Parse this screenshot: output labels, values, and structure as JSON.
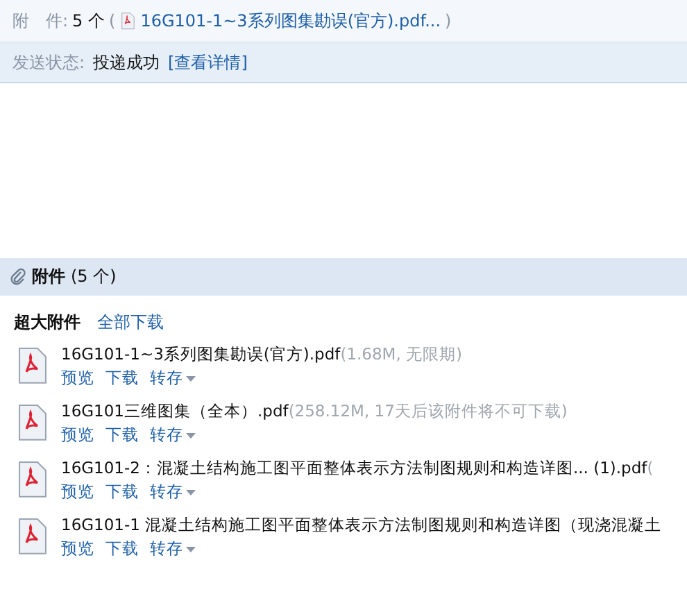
{
  "summary": {
    "attach_label": "附　件:",
    "attach_count": "5 个",
    "attach_open": "(",
    "attach_first": "16G101-1~3系列图集勘误(官方).pdf...",
    "attach_close": ")"
  },
  "status": {
    "label": "发送状态:",
    "value": "投递成功",
    "link": "[查看详情]"
  },
  "attachments": {
    "title": "附件",
    "count": "(5 个)",
    "group_label": "超大附件",
    "download_all": "全部下载",
    "files": [
      {
        "name": "16G101-1~3系列图集勘误(官方).pdf",
        "meta": "(1.68M, 无限期)",
        "actions": [
          "预览",
          "下载"
        ],
        "save": "转存"
      },
      {
        "name": "16G101三维图集（全本）.pdf",
        "meta": "(258.12M, 17天后该附件将不可下载)",
        "actions": [
          "预览",
          "下载"
        ],
        "save": "转存"
      },
      {
        "name": "16G101-2：混凝土结构施工图平面整体表示方法制图规则和构造详图... (1).pdf",
        "meta": "(",
        "actions": [
          "预览",
          "下载"
        ],
        "save": "转存"
      },
      {
        "name": "16G101-1 混凝土结构施工图平面整体表示方法制图规则和构造详图（现浇混凝土",
        "actions": [
          "预览",
          "下载"
        ],
        "save": "转存"
      }
    ]
  }
}
